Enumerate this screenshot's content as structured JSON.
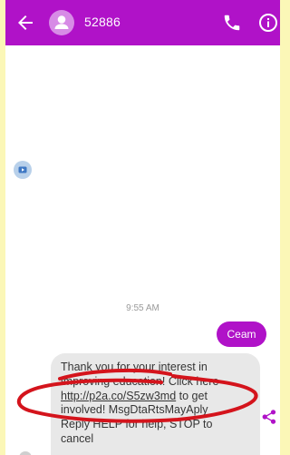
{
  "header": {
    "title": "52886",
    "back_icon": "back-arrow-icon",
    "avatar_icon": "person-icon",
    "call_icon": "phone-icon",
    "info_icon": "info-icon",
    "bar_color": "#b012c8"
  },
  "conversation": {
    "timestamp": "9:55 AM",
    "outgoing": {
      "text": "Ceam"
    },
    "incoming": {
      "lines": [
        "Thank you for your interest in",
        "improving education! Click here",
        "to get",
        "involved! MsgDtaRtsMayAply",
        "Reply HELP for help, STOP to",
        "cancel"
      ],
      "link": "http://p2a.co/S5zw3md"
    },
    "share_icon": "share-icon"
  },
  "colors": {
    "accent": "#b012c8",
    "incoming_bubble": "#e8e8e8",
    "annotation_red": "#d4141c"
  }
}
